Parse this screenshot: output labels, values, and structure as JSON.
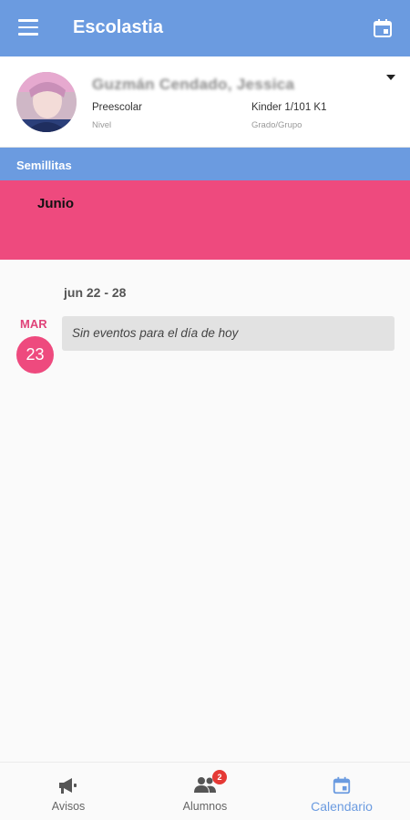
{
  "app": {
    "title": "Escolastia"
  },
  "student": {
    "name": "Guzmán Cendado, Jessica",
    "level": "Preescolar",
    "level_label": "Nivel",
    "group": "Kinder 1/101 K1",
    "group_label": "Grado/Grupo"
  },
  "group_name": "Semillitas",
  "month": "Junio",
  "week": {
    "range": "jun 22 - 28",
    "day_abbr": "MAR",
    "day_number": "23",
    "event_text": "Sin eventos para el día de hoy"
  },
  "nav": {
    "items": [
      {
        "label": "Avisos",
        "icon": "megaphone-icon"
      },
      {
        "label": "Alumnos",
        "icon": "people-icon",
        "badge": "2"
      },
      {
        "label": "Calendario",
        "icon": "calendar-icon",
        "active": true
      }
    ]
  },
  "colors": {
    "primary": "#6b9be0",
    "accent": "#ee4a7e",
    "badge": "#e53935"
  }
}
